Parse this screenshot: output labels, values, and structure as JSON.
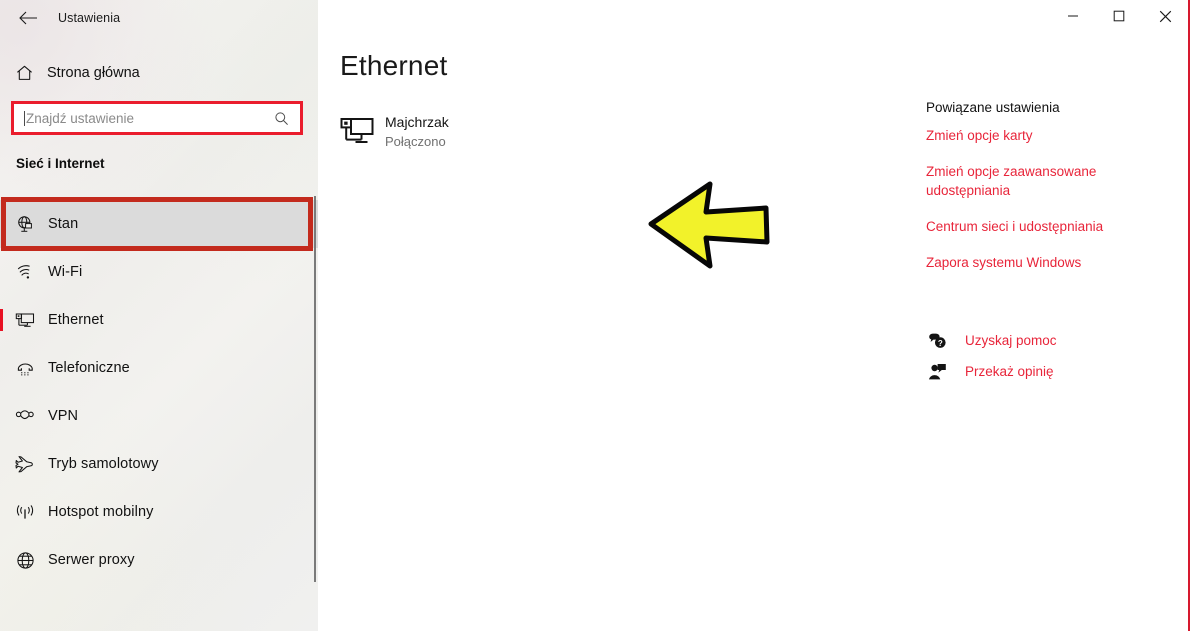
{
  "window": {
    "title": "Ustawienia",
    "back_icon": "back-arrow-icon",
    "minimize_label": "—",
    "maximize_label": "□",
    "close_label": "✕"
  },
  "sidebar": {
    "home": {
      "label": "Strona główna",
      "icon": "home-icon"
    },
    "search": {
      "placeholder": "Znajdź ustawienie",
      "value": "",
      "icon": "search-icon"
    },
    "section_title": "Sieć i Internet",
    "items": [
      {
        "label": "Stan",
        "icon": "status-globe-icon",
        "selected": true
      },
      {
        "label": "Wi-Fi",
        "icon": "wifi-icon",
        "selected": false
      },
      {
        "label": "Ethernet",
        "icon": "ethernet-icon",
        "selected": false,
        "accent": true
      },
      {
        "label": "Telefoniczne",
        "icon": "dial-up-phone-icon",
        "selected": false
      },
      {
        "label": "VPN",
        "icon": "vpn-icon",
        "selected": false
      },
      {
        "label": "Tryb samolotowy",
        "icon": "airplane-icon",
        "selected": false
      },
      {
        "label": "Hotspot mobilny",
        "icon": "mobile-hotspot-icon",
        "selected": false
      },
      {
        "label": "Serwer proxy",
        "icon": "proxy-globe-icon",
        "selected": false
      }
    ]
  },
  "main": {
    "page_title": "Ethernet",
    "connection": {
      "name": "Majchrzak",
      "status": "Połączono",
      "icon": "ethernet-monitor-icon"
    }
  },
  "related": {
    "heading": "Powiązane ustawienia",
    "links": [
      "Zmień opcje karty",
      "Zmień opcje zaawansowane udostępniania",
      "Centrum sieci i udostępniania",
      "Zapora systemu Windows"
    ]
  },
  "help": {
    "items": [
      {
        "label": "Uzyskaj pomoc",
        "icon": "help-question-bubble-icon"
      },
      {
        "label": "Przekaż opinię",
        "icon": "feedback-person-icon"
      }
    ]
  },
  "annotations": {
    "search_box_highlight_color": "#ea1d2d",
    "selected_item_highlight_color": "#c32a1d",
    "arrow_fill_color": "#f2f22a",
    "arrow_outline_color": "#000000",
    "accent_color": "#e81123",
    "link_color": "#e8253a",
    "edge_line_color": "#d6192e"
  }
}
